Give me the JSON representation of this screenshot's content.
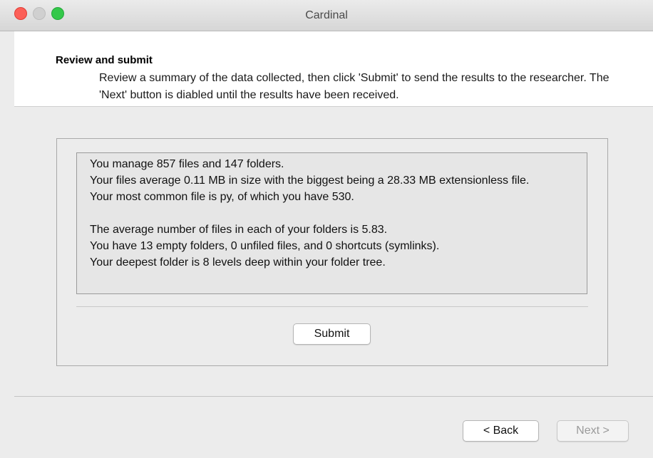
{
  "window": {
    "title": "Cardinal"
  },
  "header": {
    "title": "Review and submit",
    "description": "Review a summary of the data collected, then click 'Submit' to send the results to the researcher. The 'Next' button is diabled until the results have been received."
  },
  "summary": {
    "lines": [
      "You manage 857 files and 147 folders.",
      "Your files average 0.11 MB in size with the biggest being a 28.33 MB extensionless file.",
      "Your most common file is py, of which you have 530.",
      "",
      "The average number of files in each of your folders is 5.83.",
      "You have 13 empty folders, 0 unfiled files, and 0 shortcuts (symlinks).",
      "Your deepest folder is 8 levels deep within your folder tree."
    ]
  },
  "buttons": {
    "submit": "Submit",
    "back": "< Back",
    "next": "Next >"
  },
  "colors": {
    "close": "#fc5f57",
    "minimize": "#d0d0d0",
    "zoom": "#34c84a"
  }
}
